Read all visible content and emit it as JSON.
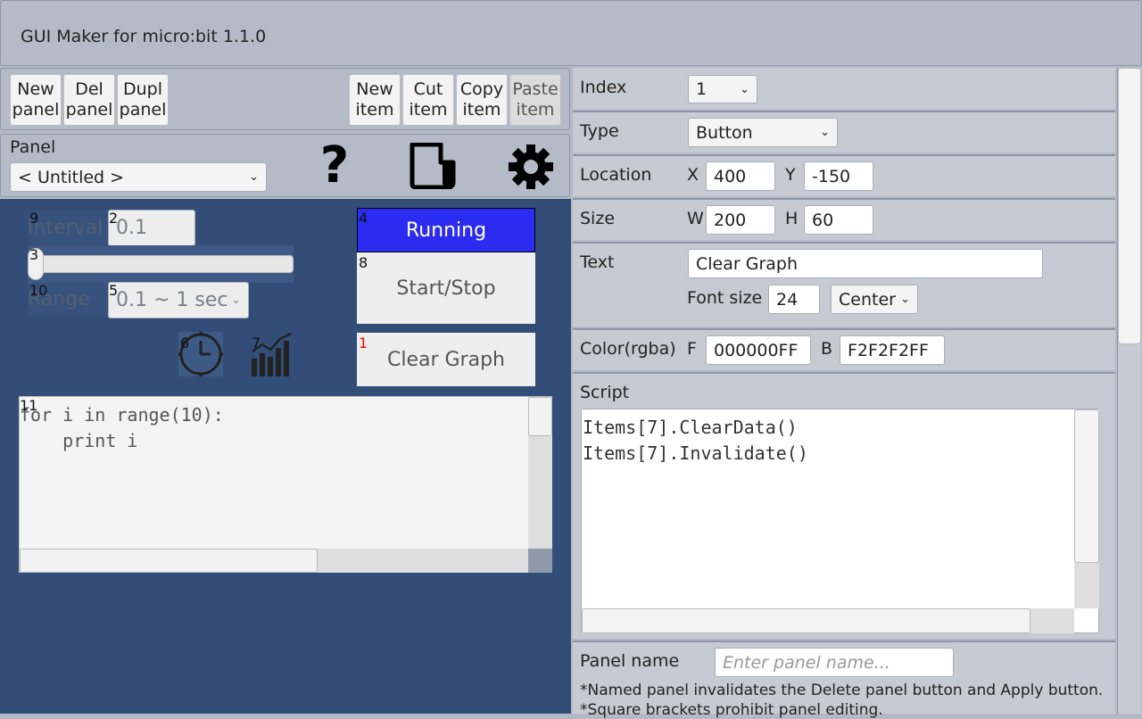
{
  "app": {
    "title": "GUI Maker for micro:bit 1.1.0"
  },
  "toolbar": {
    "new_panel": "New\npanel",
    "del_panel": "Del\npanel",
    "dupl_panel": "Dupl\npanel",
    "new_item": "New\nitem",
    "cut_item": "Cut\nitem",
    "copy_item": "Copy\nitem",
    "paste_item": "Paste\nitem"
  },
  "panel": {
    "label": "Panel",
    "selected": "< Untitled >",
    "help_icon": "question-icon",
    "file_icon": "document-icon",
    "settings_icon": "gear-icon"
  },
  "canvas": {
    "interval_label": "Interval",
    "interval_value": "0.1",
    "range_label": "Range",
    "range_value": "0.1 ~ 1 sec",
    "running_label": "Running",
    "startstop_label": "Start/Stop",
    "clear_label": "Clear Graph",
    "script_line1": "for i in range(10):",
    "script_line2": "    print i",
    "badges": {
      "b9": "9",
      "b2": "2",
      "b3": "3",
      "b10": "10",
      "b5": "5",
      "b4": "4",
      "b8": "8",
      "b1": "1",
      "b6": "6",
      "b7": "7",
      "b11": "11"
    },
    "slider_value": 0.0,
    "colors": {
      "running_bg": "#2c2cf0",
      "canvas_bg": "#314d78",
      "badge_red": "#ff0000"
    }
  },
  "props": {
    "index_label": "Index",
    "index_value": "1",
    "type_label": "Type",
    "type_value": "Button",
    "location_label": "Location",
    "x_label": "X",
    "x_value": "400",
    "y_label": "Y",
    "y_value": "-150",
    "size_label": "Size",
    "w_label": "W",
    "w_value": "200",
    "h_label": "H",
    "h_value": "60",
    "text_label": "Text",
    "text_value": "Clear Graph",
    "fontsize_label": "Font size",
    "fontsize_value": "24",
    "align_value": "Center",
    "color_label": "Color(rgba)",
    "f_label": "F",
    "f_value": "000000FF",
    "b_label": "B",
    "b_value": "F2F2F2FF",
    "script_label": "Script",
    "script_line1": "Items[7].ClearData()",
    "script_line2": "Items[7].Invalidate()",
    "panelname_label": "Panel name",
    "panelname_placeholder": "Enter panel name...",
    "note1": "*Named panel invalidates the Delete panel button and Apply button.",
    "note2": "*Square brackets prohibit panel editing."
  }
}
